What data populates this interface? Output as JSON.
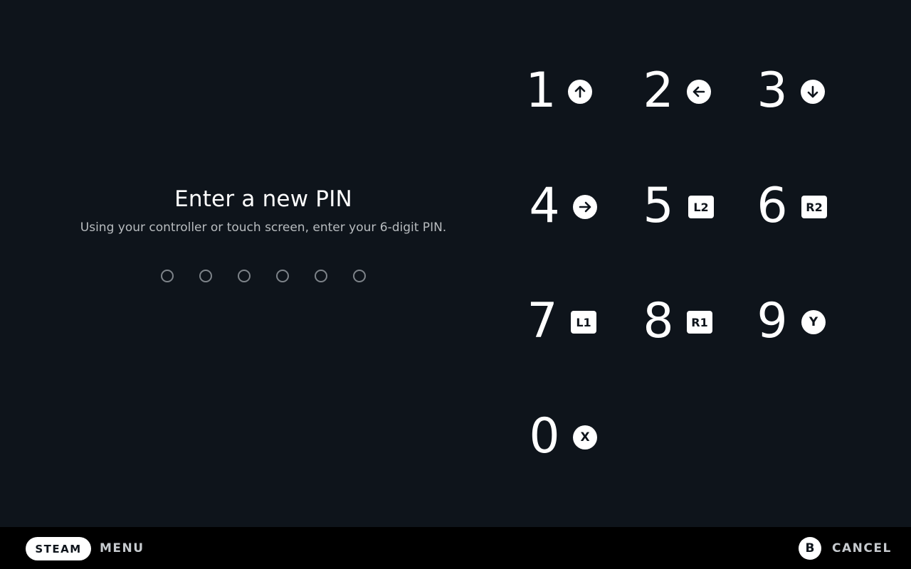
{
  "pin_prompt": {
    "title": "Enter a new PIN",
    "subtitle": "Using your controller or touch screen, enter your 6-digit PIN.",
    "digits_required": 6,
    "digits_entered": 0
  },
  "keypad": {
    "keys": [
      {
        "digit": "1",
        "button_label": "",
        "button_icon": "arrow-up-icon"
      },
      {
        "digit": "2",
        "button_label": "",
        "button_icon": "arrow-left-icon"
      },
      {
        "digit": "3",
        "button_label": "",
        "button_icon": "arrow-down-icon"
      },
      {
        "digit": "4",
        "button_label": "",
        "button_icon": "arrow-right-icon"
      },
      {
        "digit": "5",
        "button_label": "L2",
        "button_icon": "l2-trigger-icon"
      },
      {
        "digit": "6",
        "button_label": "R2",
        "button_icon": "r2-trigger-icon"
      },
      {
        "digit": "7",
        "button_label": "L1",
        "button_icon": "l1-bumper-icon"
      },
      {
        "digit": "8",
        "button_label": "R1",
        "button_icon": "r1-bumper-icon"
      },
      {
        "digit": "9",
        "button_label": "Y",
        "button_icon": "y-button-icon"
      },
      {
        "digit": "0",
        "button_label": "X",
        "button_icon": "x-button-icon"
      }
    ]
  },
  "footer": {
    "steam_label": "STEAM",
    "menu_label": "MENU",
    "cancel_button_glyph": "B",
    "cancel_label": "CANCEL"
  },
  "colors": {
    "background": "#0e141b",
    "footer_background": "#000000",
    "glyph_background": "#ffffff",
    "pin_dot_outline": "#7d8389"
  }
}
